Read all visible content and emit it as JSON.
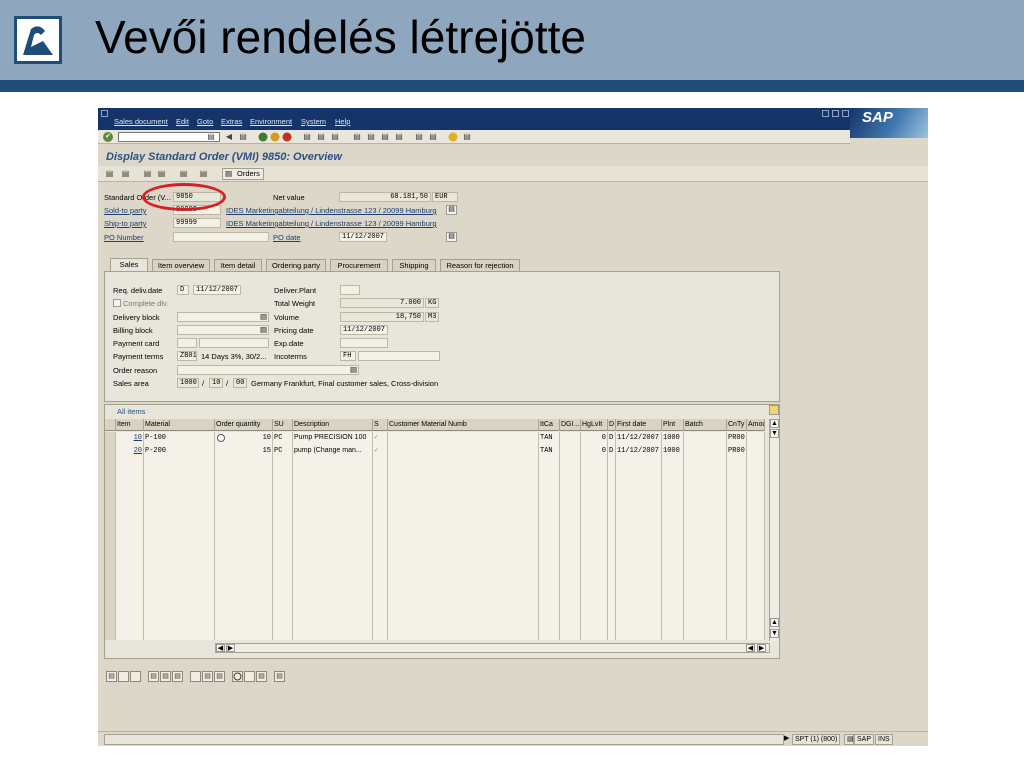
{
  "slide": {
    "title": "Vevői rendelés létrejötte"
  },
  "menu": {
    "items": [
      "Sales document",
      "Edit",
      "Goto",
      "Extras",
      "Environment",
      "System",
      "Help"
    ],
    "logo": "SAP"
  },
  "screen": {
    "title": "Display Standard Order (VMI) 9850: Overview",
    "orders_button": "Orders"
  },
  "header": {
    "std_order_label": "Standard Order (V...",
    "std_order_value": "9850",
    "net_value_label": "Net value",
    "net_value": "68.181,50",
    "currency": "EUR",
    "sold_to_label": "Sold-to party",
    "sold_to_value": "99999",
    "sold_to_desc": "IDES Marketingabteilung / Lindenstrasse 123 / 20099 Hamburg",
    "ship_to_label": "Ship-to party",
    "ship_to_value": "99999",
    "ship_to_desc": "IDES Marketingabteilung / Lindenstrasse 123 / 20099 Hamburg",
    "po_number_label": "PO Number",
    "po_date_label": "PO date",
    "po_date": "11/12/2007"
  },
  "tabs": [
    "Sales",
    "Item overview",
    "Item detail",
    "Ordering party",
    "Procurement",
    "Shipping",
    "Reason for rejection"
  ],
  "sales": {
    "req_deliv_label": "Req. deliv.date",
    "req_deliv_type": "D",
    "req_deliv_date": "11/12/2007",
    "deliver_plant_label": "Deliver.Plant",
    "complete_dlv_label": "Complete dlv.",
    "total_weight_label": "Total Weight",
    "total_weight": "7.000",
    "weight_unit": "KG",
    "delivery_block_label": "Delivery block",
    "volume_label": "Volume",
    "volume": "18,750",
    "volume_unit": "M3",
    "billing_block_label": "Billing block",
    "pricing_date_label": "Pricing date",
    "pricing_date": "11/12/2007",
    "payment_card_label": "Payment card",
    "exp_date_label": "Exp.date",
    "payment_terms_label": "Payment terms",
    "payment_terms_code": "ZB01",
    "payment_terms_desc": "14 Days 3%, 30/2...",
    "incoterms_label": "Incoterms",
    "incoterms_value": "FH",
    "order_reason_label": "Order reason",
    "sales_area_label": "Sales area",
    "sales_org": "1000",
    "dist_channel": "10",
    "division": "00",
    "sales_area_desc": "Germany Frankfurt, Final customer sales, Cross-division",
    "sep": "/"
  },
  "grid": {
    "title": "All items",
    "columns": [
      "Item",
      "Material",
      "Order quantity",
      "SU",
      "Description",
      "S",
      "Customer Material Numb",
      "ItCa",
      "DGI...",
      "HgLvIt",
      "D",
      "First date",
      "Plnt",
      "Batch",
      "CnTy",
      "Amou"
    ],
    "rows": [
      {
        "item": "10",
        "material": "P-100",
        "qty": "10",
        "su": "PC",
        "desc": "Pump PRECISION 100",
        "itca": "TAN",
        "hglvit": "0",
        "d": "D",
        "first_date": "11/12/2007",
        "plant": "1000",
        "cnty": "PR00"
      },
      {
        "item": "20",
        "material": "P-200",
        "qty": "15",
        "su": "PC",
        "desc": "pump   (Change man...",
        "itca": "TAN",
        "hglvit": "0",
        "d": "D",
        "first_date": "11/12/2007",
        "plant": "1000",
        "cnty": "PR00"
      }
    ]
  },
  "status": {
    "system": "SPT (1) (800)",
    "client": "SAP",
    "mode": "INS"
  },
  "icons": {
    "checkmark": "✔",
    "page": "▤",
    "dropdown": "▼",
    "arrow_left": "◀",
    "arrow_right": "▶",
    "arrow_up": "▲",
    "arrow_down": "▼",
    "check": "✓",
    "link": "⇗"
  }
}
